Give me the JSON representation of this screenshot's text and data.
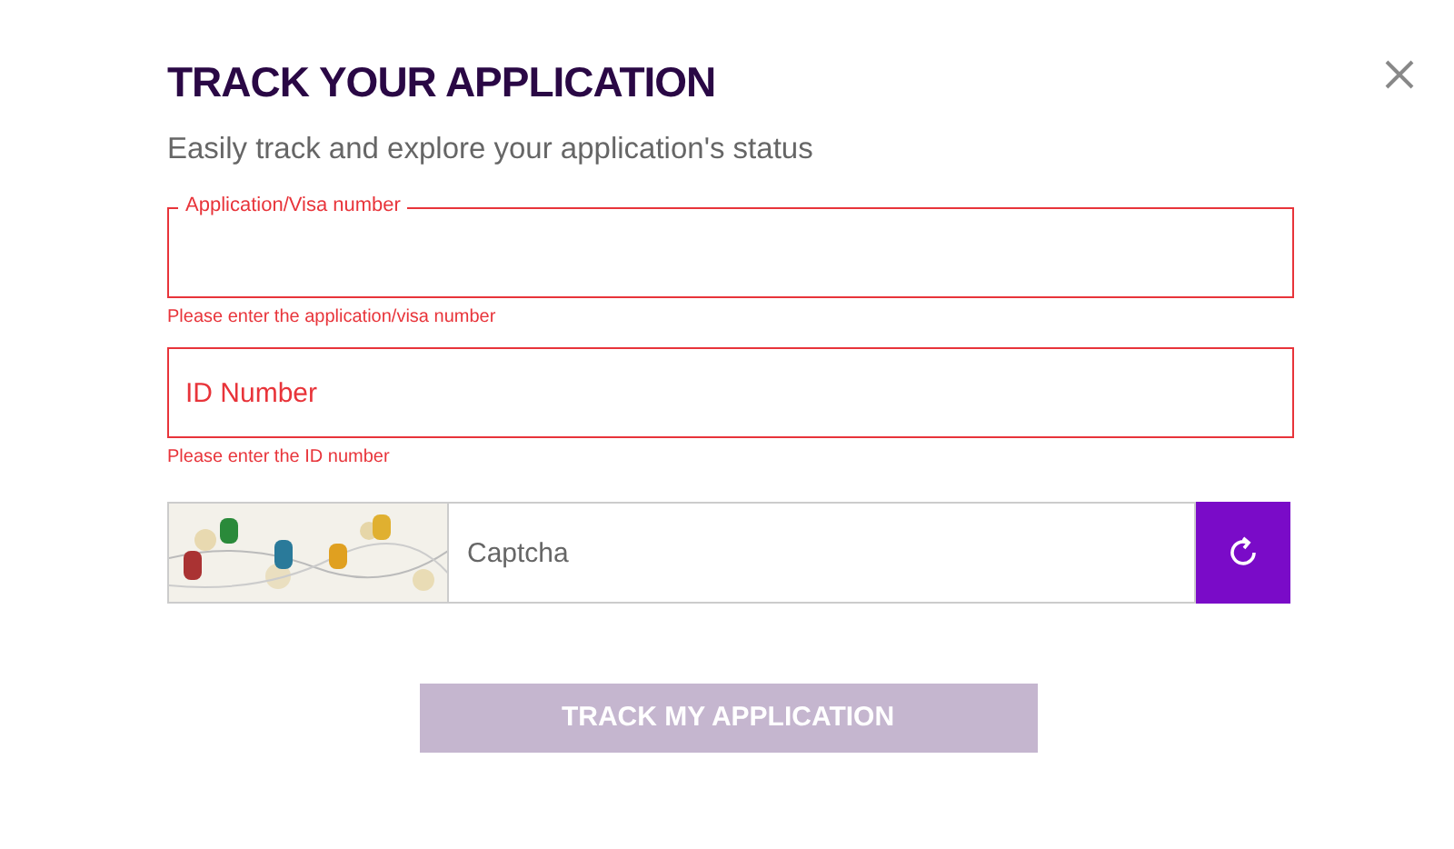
{
  "dialog": {
    "title": "TRACK YOUR APPLICATION",
    "subtitle": "Easily track and explore your application's status"
  },
  "fields": [
    {
      "kind": "floating",
      "label": "Application/Visa number",
      "invalid": true,
      "error": "Please enter the application/visa number"
    },
    {
      "kind": "placeholder",
      "placeholder": "ID Number",
      "invalid": true,
      "error": "Please enter the ID number"
    }
  ],
  "captcha": {
    "placeholder": "Captcha"
  },
  "submit": {
    "label": "TRACK MY APPLICATION",
    "disabled": true
  }
}
